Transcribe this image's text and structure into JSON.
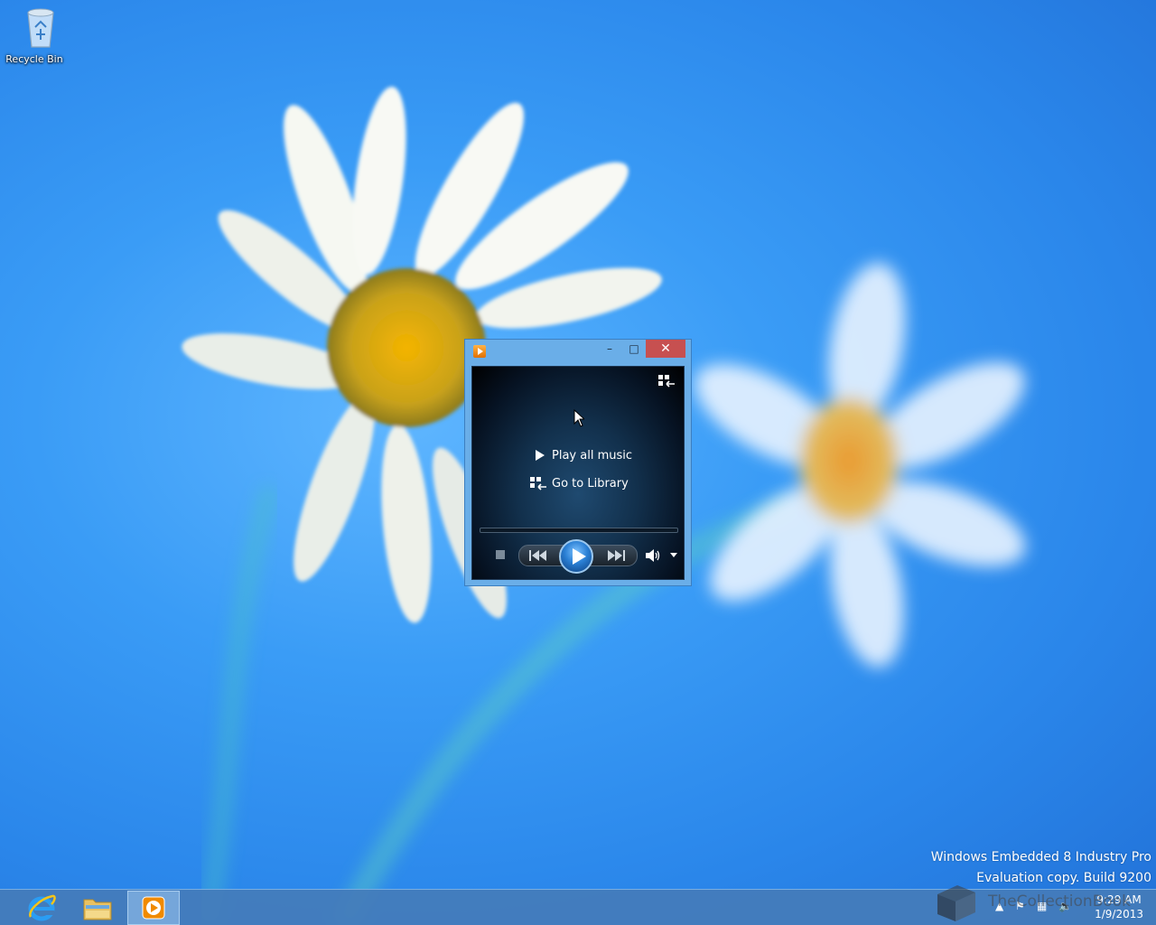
{
  "desktop": {
    "icons": [
      {
        "label": "Recycle Bin",
        "icon": "recycle-bin-icon"
      }
    ]
  },
  "wmp": {
    "title_icon": "windows-media-player-icon",
    "controls": {
      "minimize": "–",
      "maximize": "□",
      "close": "✕"
    },
    "menu": {
      "play_all": "Play all music",
      "go_to_library": "Go to Library"
    },
    "transport": {
      "stop": "stop-icon",
      "previous": "previous-icon",
      "play": "play-icon",
      "next": "next-icon",
      "volume": "speaker-icon"
    }
  },
  "watermark": {
    "line1": "Windows Embedded 8 Industry Pro",
    "line2": "Evaluation copy. Build 9200",
    "overlay": "TheCollectionBook"
  },
  "taskbar": {
    "items": [
      {
        "name": "Internet Explorer",
        "icon": "internet-explorer-icon"
      },
      {
        "name": "File Explorer",
        "icon": "folder-icon"
      },
      {
        "name": "Windows Media Player",
        "icon": "windows-media-player-icon",
        "active": true
      }
    ],
    "tray": {
      "time": "9:29 AM",
      "date": "1/9/2013"
    }
  },
  "colors": {
    "wallpaper": "#3a9cf6",
    "close_button": "#c75050",
    "taskbar": "#447cba"
  }
}
